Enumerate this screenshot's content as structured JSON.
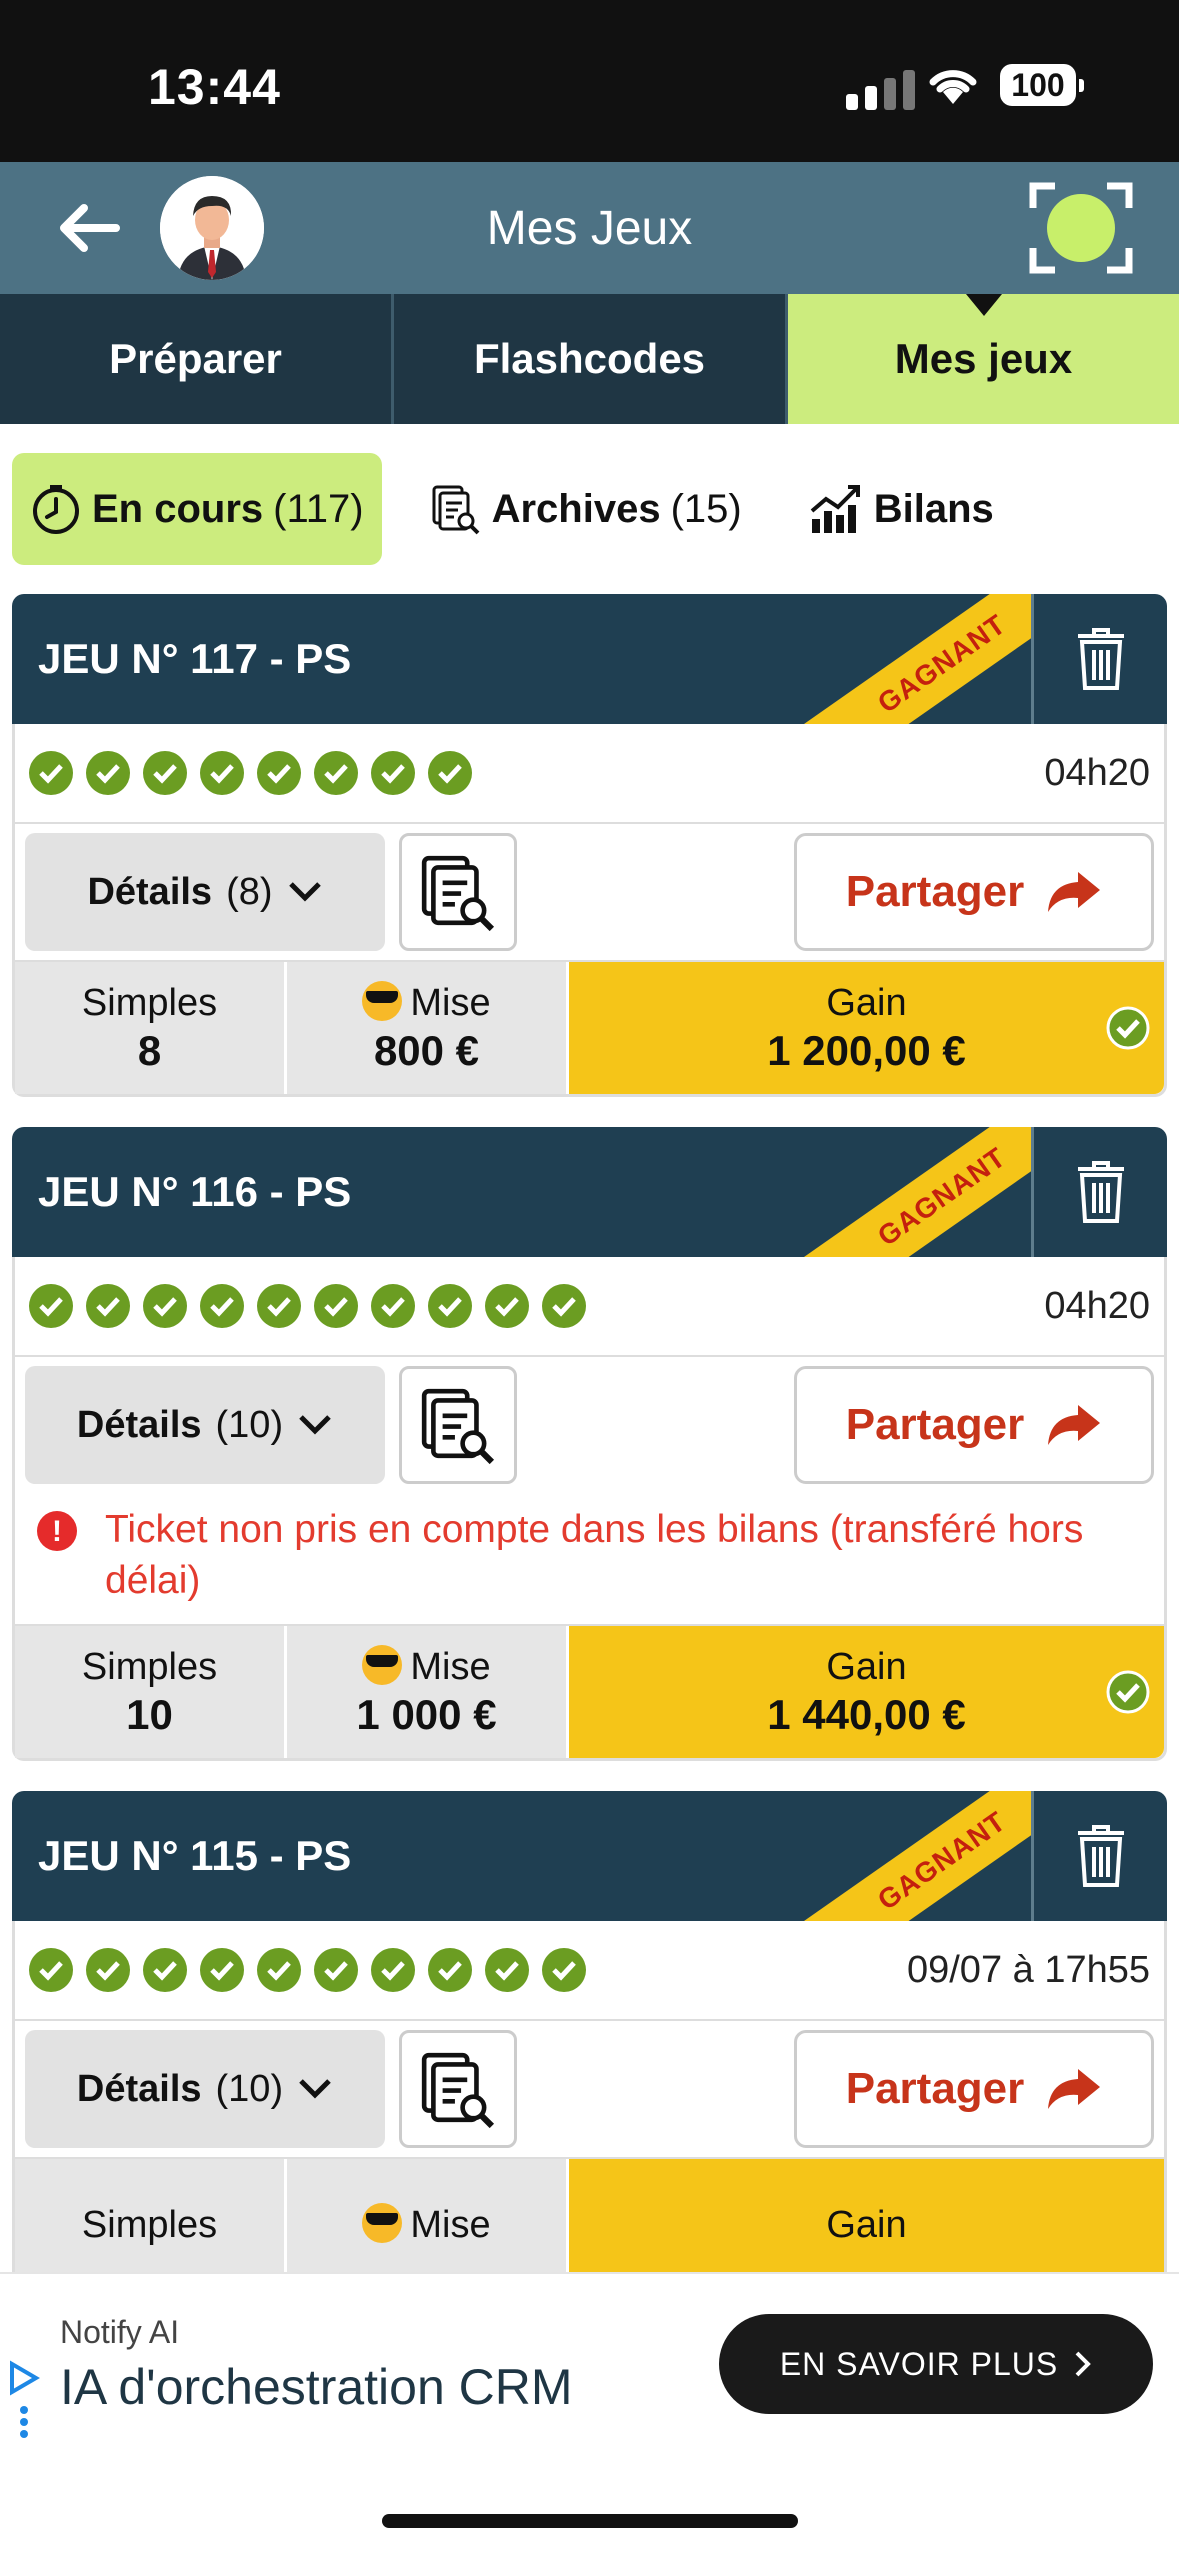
{
  "status_bar": {
    "time": "13:44",
    "battery": "100"
  },
  "header": {
    "title": "Mes Jeux"
  },
  "tabs": [
    {
      "label": "Préparer"
    },
    {
      "label": "Flashcodes"
    },
    {
      "label": "Mes jeux"
    }
  ],
  "subtabs": [
    {
      "label": "En cours",
      "count": "(117)"
    },
    {
      "label": "Archives",
      "count": "(15)"
    },
    {
      "label": "Bilans",
      "count": ""
    }
  ],
  "games": [
    {
      "title": "JEU N° 117 - PS",
      "badge": "GAGNANT",
      "checks": 8,
      "time": "04h20",
      "details_label": "Détails",
      "details_count": "(8)",
      "share_label": "Partager",
      "warning": "",
      "simples_label": "Simples",
      "simples_value": "8",
      "mise_label": "Mise",
      "mise_value": "800 €",
      "gain_label": "Gain",
      "gain_value": "1 200,00 €"
    },
    {
      "title": "JEU N° 116 - PS",
      "badge": "GAGNANT",
      "checks": 10,
      "time": "04h20",
      "details_label": "Détails",
      "details_count": "(10)",
      "share_label": "Partager",
      "warning": "Ticket non pris en compte dans les bilans (transféré hors délai)",
      "simples_label": "Simples",
      "simples_value": "10",
      "mise_label": "Mise",
      "mise_value": "1 000 €",
      "gain_label": "Gain",
      "gain_value": "1 440,00 €"
    },
    {
      "title": "JEU N° 115 - PS",
      "badge": "GAGNANT",
      "checks": 10,
      "time": "09/07 à 17h55",
      "details_label": "Détails",
      "details_count": "(10)",
      "share_label": "Partager",
      "simples_label": "Simples",
      "mise_label": "Mise",
      "gain_label": "Gain"
    }
  ],
  "ad": {
    "sponsor": "Notify AI",
    "headline": "IA d'orchestration CRM",
    "cta": "EN SAVOIR PLUS"
  },
  "colors": {
    "accent_green": "#ccec7e",
    "dark_teal": "#1f3f52",
    "gain_yellow": "#f5c518",
    "share_red": "#c7341a",
    "check_green": "#6b9d22"
  }
}
